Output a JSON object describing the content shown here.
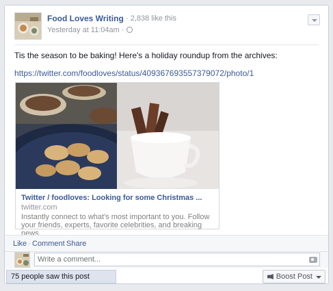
{
  "post": {
    "page_name": "Food Loves Writing",
    "likes": "· 2,838 like this",
    "timestamp": "Yesterday at 11:04am ·",
    "message": "Tis the season to be baking! Here's a holiday roundup from the archives:",
    "url": "https://twitter.com/foodloves/status/409367693557379072/photo/1"
  },
  "attachment": {
    "title": "Twitter / foodloves: Looking for some Christmas ...",
    "domain": "twitter.com",
    "description": "Instantly connect to what's most important to you. Follow your friends, experts, favorite celebrities, and breaking news."
  },
  "actions": {
    "like": "Like",
    "comment": "Comment",
    "share": "Share",
    "separator": "·"
  },
  "comment_box": {
    "placeholder": "Write a comment..."
  },
  "footer": {
    "reach": "75 people saw this post",
    "boost": "Boost Post"
  },
  "icons": {
    "privacy": "globe-icon",
    "options": "chevron-down-icon",
    "camera": "camera-icon",
    "boost": "megaphone-icon"
  },
  "colors": {
    "link": "#3b5998",
    "muted": "#90949c",
    "bar_bg": "#f6f7f9"
  }
}
